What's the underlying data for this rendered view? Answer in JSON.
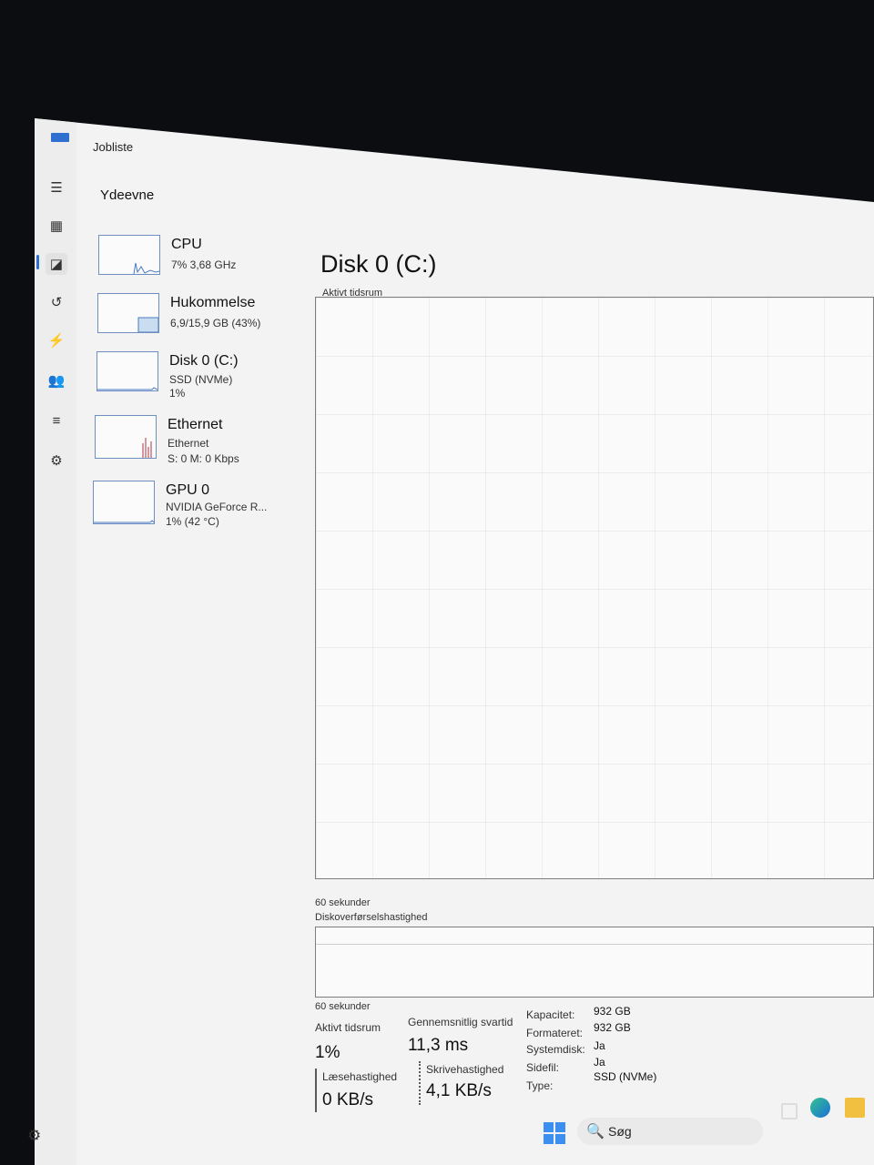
{
  "app": {
    "title": "Jobliste",
    "section": "Ydeevne"
  },
  "nav": {
    "items": [
      {
        "icon": "hamburger-menu-icon",
        "glyph": "☰"
      },
      {
        "icon": "processes-icon",
        "glyph": "▦"
      },
      {
        "icon": "performance-icon",
        "glyph": "◪",
        "active": true
      },
      {
        "icon": "app-history-icon",
        "glyph": "↺"
      },
      {
        "icon": "startup-apps-icon",
        "glyph": "⚡"
      },
      {
        "icon": "users-icon",
        "glyph": "👥"
      },
      {
        "icon": "details-icon",
        "glyph": "≡"
      },
      {
        "icon": "services-icon",
        "glyph": "⚙"
      }
    ],
    "settings_glyph": "⚙"
  },
  "perf_items": [
    {
      "title": "CPU",
      "lines": [
        "7% 3,68 GHz"
      ]
    },
    {
      "title": "Hukommelse",
      "lines": [
        "6,9/15,9 GB (43%)"
      ]
    },
    {
      "title": "Disk 0 (C:)",
      "lines": [
        "SSD (NVMe)",
        "1%"
      ]
    },
    {
      "title": "Ethernet",
      "lines": [
        "Ethernet",
        "S: 0 M: 0 Kbps"
      ]
    },
    {
      "title": "GPU 0",
      "lines": [
        "NVIDIA GeForce R...",
        "1% (42 °C)"
      ]
    }
  ],
  "main": {
    "title": "Disk 0 (C:)",
    "graph1_label": "Aktivt tidsrum",
    "graph1_footer": "60 sekunder",
    "graph2_label": "Diskoverførselshastighed",
    "graph2_footer": "60 sekunder"
  },
  "stats": {
    "active_time_label": "Aktivt tidsrum",
    "active_time_value": "1%",
    "avg_response_label": "Gennemsnitlig svartid",
    "avg_response_value": "11,3 ms",
    "read_label": "Læsehastighed",
    "read_value": "0 KB/s",
    "write_label": "Skrivehastighed",
    "write_value": "4,1 KB/s"
  },
  "properties": [
    {
      "key": "Kapacitet:",
      "value": "932 GB"
    },
    {
      "key": "Formateret:",
      "value": "932 GB"
    },
    {
      "key": "Systemdisk:",
      "value": "Ja"
    },
    {
      "key": "Sidefil:",
      "value": "Ja"
    },
    {
      "key": "Type:",
      "value": "SSD (NVMe)"
    }
  ],
  "taskbar": {
    "search_placeholder": "Søg",
    "search_glyph": "🔍"
  },
  "colors": {
    "accent": "#2f6fd0",
    "graph_border": "#6c8fbf",
    "ethernet_spike": "#b03040"
  }
}
